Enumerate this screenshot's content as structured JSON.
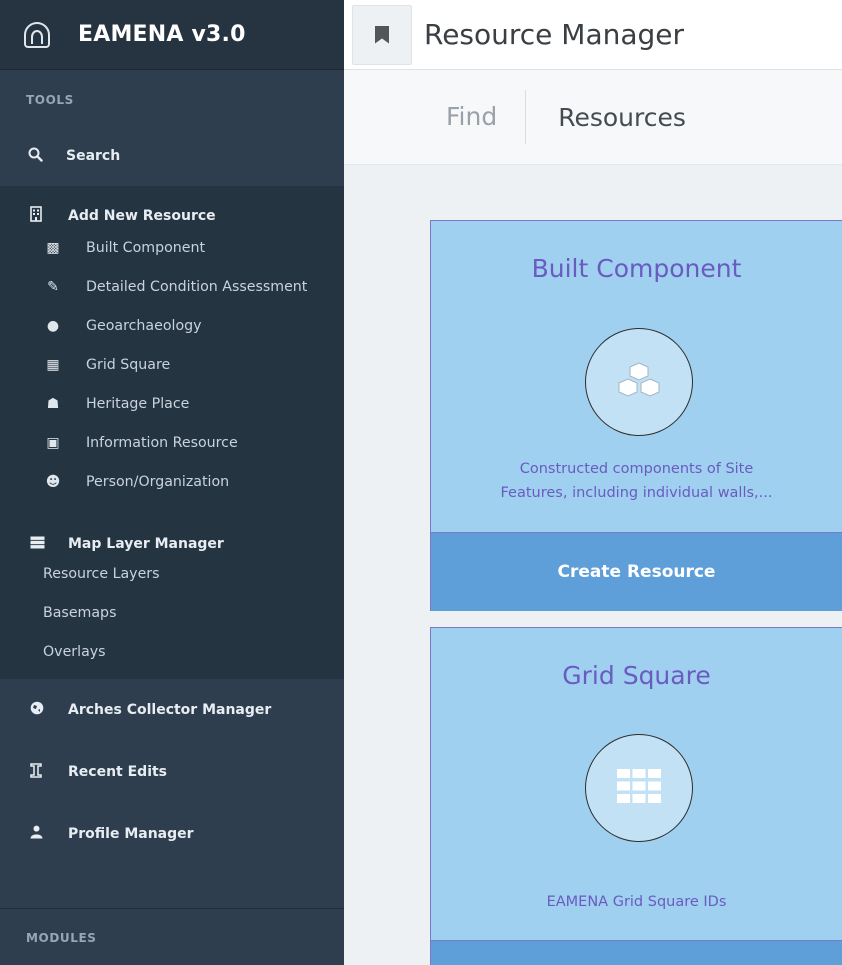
{
  "sidebar": {
    "brand": "EAMENA v3.0",
    "tools_label": "TOOLS",
    "search_label": "Search",
    "add_new_resource": {
      "label": "Add New Resource",
      "items": [
        {
          "label": "Built Component",
          "icon": "cubes-icon"
        },
        {
          "label": "Detailed Condition Assessment",
          "icon": "edit-icon"
        },
        {
          "label": "Geoarchaeology",
          "icon": "globe-icon"
        },
        {
          "label": "Grid Square",
          "icon": "grid-icon"
        },
        {
          "label": "Heritage Place",
          "icon": "institution-icon"
        },
        {
          "label": "Information Resource",
          "icon": "image-file-icon"
        },
        {
          "label": "Person/Organization",
          "icon": "users-icon"
        }
      ]
    },
    "map_layer_manager": {
      "label": "Map Layer Manager",
      "items": [
        "Resource Layers",
        "Basemaps",
        "Overlays"
      ]
    },
    "arches_collector_manager": "Arches Collector Manager",
    "recent_edits": "Recent Edits",
    "profile_manager": "Profile Manager",
    "modules_label": "MODULES"
  },
  "header": {
    "title": "Resource Manager",
    "breadcrumb_find": "Find",
    "breadcrumb_resources": "Resources"
  },
  "cards": [
    {
      "title": "Built Component",
      "icon": "cubes-icon",
      "description_line1": "Constructed components of Site",
      "description_line2": "Features, including individual walls,...",
      "button": "Create Resource"
    },
    {
      "title": "Grid Square",
      "icon": "grid-icon",
      "description": "EAMENA Grid Square IDs",
      "button": ""
    }
  ],
  "colors": {
    "sidebar": "#2e3e4e",
    "card_bg": "#9fd0ef",
    "card_text": "#6a5bc1",
    "button": "#5f9fd9"
  }
}
